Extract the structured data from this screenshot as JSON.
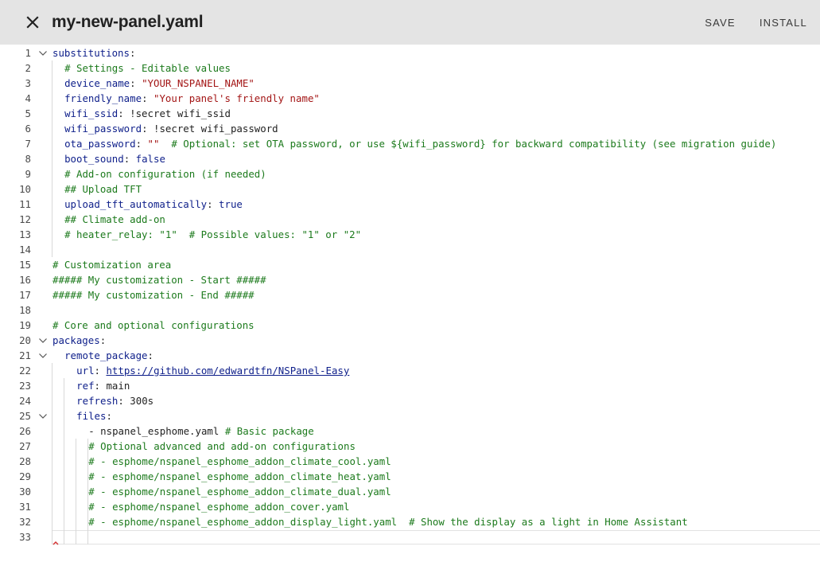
{
  "header": {
    "title": "my-new-panel.yaml",
    "save_label": "SAVE",
    "install_label": "INSTALL"
  },
  "editor": {
    "lines": [
      {
        "n": "1",
        "fold": true,
        "indent": 0,
        "parts": [
          [
            "k",
            "substitutions"
          ],
          [
            "p",
            ":"
          ]
        ]
      },
      {
        "n": "2",
        "indent": 2,
        "parts": [
          [
            "c",
            "# Settings - Editable values"
          ]
        ]
      },
      {
        "n": "3",
        "indent": 2,
        "parts": [
          [
            "k",
            "device_name"
          ],
          [
            "p",
            ": "
          ],
          [
            "s",
            "\"YOUR_NSPANEL_NAME\""
          ]
        ]
      },
      {
        "n": "4",
        "indent": 2,
        "parts": [
          [
            "k",
            "friendly_name"
          ],
          [
            "p",
            ": "
          ],
          [
            "s",
            "\"Your panel's friendly name\""
          ]
        ]
      },
      {
        "n": "5",
        "indent": 2,
        "parts": [
          [
            "k",
            "wifi_ssid"
          ],
          [
            "p",
            ": "
          ],
          [
            "p",
            "!secret wifi_ssid"
          ]
        ]
      },
      {
        "n": "6",
        "indent": 2,
        "parts": [
          [
            "k",
            "wifi_password"
          ],
          [
            "p",
            ": "
          ],
          [
            "p",
            "!secret wifi_password"
          ]
        ]
      },
      {
        "n": "7",
        "indent": 2,
        "parts": [
          [
            "k",
            "ota_password"
          ],
          [
            "p",
            ": "
          ],
          [
            "s",
            "\"\""
          ],
          [
            "p",
            "  "
          ],
          [
            "c",
            "# Optional: set OTA password, or use ${wifi_password} for backward compatibility (see migration guide)"
          ]
        ]
      },
      {
        "n": "8",
        "indent": 2,
        "parts": [
          [
            "k",
            "boot_sound"
          ],
          [
            "p",
            ": "
          ],
          [
            "b",
            "false"
          ]
        ]
      },
      {
        "n": "9",
        "indent": 2,
        "parts": [
          [
            "c",
            "# Add-on configuration (if needed)"
          ]
        ]
      },
      {
        "n": "10",
        "indent": 2,
        "parts": [
          [
            "c",
            "## Upload TFT"
          ]
        ]
      },
      {
        "n": "11",
        "indent": 2,
        "parts": [
          [
            "k",
            "upload_tft_automatically"
          ],
          [
            "p",
            ": "
          ],
          [
            "b",
            "true"
          ]
        ]
      },
      {
        "n": "12",
        "indent": 2,
        "parts": [
          [
            "c",
            "## Climate add-on"
          ]
        ]
      },
      {
        "n": "13",
        "indent": 2,
        "parts": [
          [
            "c",
            "# heater_relay: \"1\"  # Possible values: \"1\" or \"2\""
          ]
        ]
      },
      {
        "n": "14",
        "indent": 0,
        "parts": []
      },
      {
        "n": "15",
        "indent": 0,
        "parts": [
          [
            "c",
            "# Customization area"
          ]
        ]
      },
      {
        "n": "16",
        "indent": 0,
        "parts": [
          [
            "c",
            "##### My customization - Start #####"
          ]
        ]
      },
      {
        "n": "17",
        "indent": 0,
        "parts": [
          [
            "c",
            "##### My customization - End #####"
          ]
        ]
      },
      {
        "n": "18",
        "indent": 0,
        "parts": []
      },
      {
        "n": "19",
        "indent": 0,
        "parts": [
          [
            "c",
            "# Core and optional configurations"
          ]
        ]
      },
      {
        "n": "20",
        "fold": true,
        "indent": 0,
        "parts": [
          [
            "k",
            "packages"
          ],
          [
            "p",
            ":"
          ]
        ]
      },
      {
        "n": "21",
        "fold": true,
        "indent": 2,
        "parts": [
          [
            "k",
            "remote_package"
          ],
          [
            "p",
            ":"
          ]
        ]
      },
      {
        "n": "22",
        "indent": 4,
        "parts": [
          [
            "k",
            "url"
          ],
          [
            "p",
            ": "
          ],
          [
            "u",
            "https://github.com/edwardtfn/NSPanel-Easy"
          ]
        ]
      },
      {
        "n": "23",
        "indent": 4,
        "parts": [
          [
            "k",
            "ref"
          ],
          [
            "p",
            ": "
          ],
          [
            "p",
            "main"
          ]
        ]
      },
      {
        "n": "24",
        "indent": 4,
        "parts": [
          [
            "k",
            "refresh"
          ],
          [
            "p",
            ": "
          ],
          [
            "p",
            "300s"
          ]
        ]
      },
      {
        "n": "25",
        "fold": true,
        "indent": 4,
        "parts": [
          [
            "k",
            "files"
          ],
          [
            "p",
            ":"
          ]
        ]
      },
      {
        "n": "26",
        "indent": 6,
        "parts": [
          [
            "p",
            "- "
          ],
          [
            "p",
            "nspanel_esphome.yaml "
          ],
          [
            "c",
            "# Basic package"
          ]
        ]
      },
      {
        "n": "27",
        "indent": 6,
        "parts": [
          [
            "c",
            "# Optional advanced and add-on configurations"
          ]
        ]
      },
      {
        "n": "28",
        "indent": 6,
        "parts": [
          [
            "c",
            "# - esphome/nspanel_esphome_addon_climate_cool.yaml"
          ]
        ]
      },
      {
        "n": "29",
        "indent": 6,
        "parts": [
          [
            "c",
            "# - esphome/nspanel_esphome_addon_climate_heat.yaml"
          ]
        ]
      },
      {
        "n": "30",
        "indent": 6,
        "parts": [
          [
            "c",
            "# - esphome/nspanel_esphome_addon_climate_dual.yaml"
          ]
        ]
      },
      {
        "n": "31",
        "indent": 6,
        "parts": [
          [
            "c",
            "# - esphome/nspanel_esphome_addon_cover.yaml"
          ]
        ]
      },
      {
        "n": "32",
        "indent": 6,
        "parts": [
          [
            "c",
            "# - esphome/nspanel_esphome_addon_display_light.yaml  # Show the display as a light in Home Assistant"
          ]
        ]
      },
      {
        "n": "33",
        "indent": 0,
        "parts": []
      }
    ]
  }
}
